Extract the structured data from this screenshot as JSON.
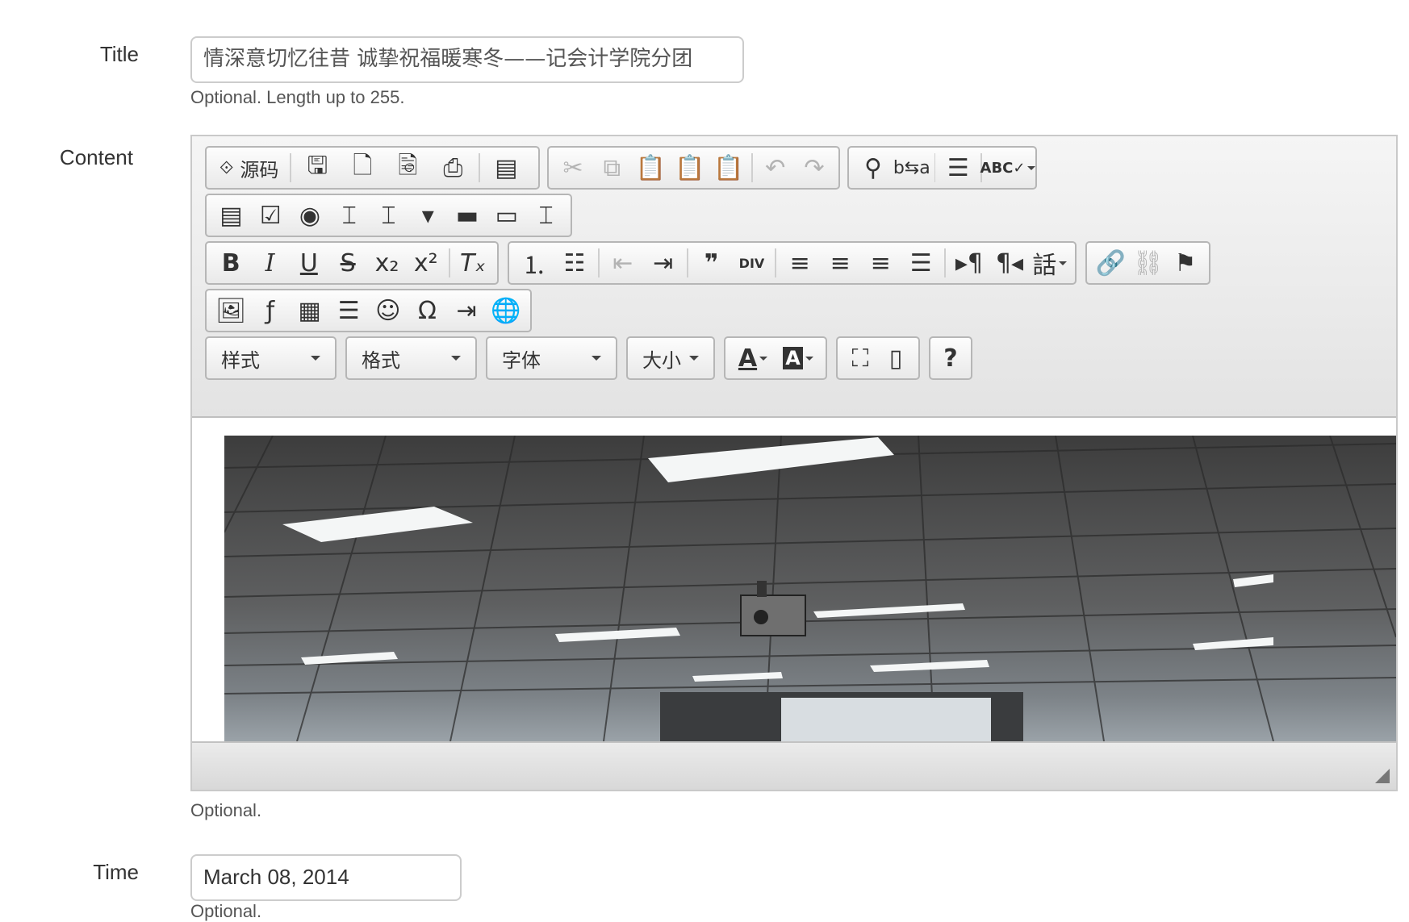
{
  "form": {
    "title_label": "Title",
    "title_value": "情深意切忆往昔 诚挚祝福暖寒冬——记会计学院分团",
    "title_help": "Optional. Length up to 255.",
    "content_label": "Content",
    "content_help": "Optional.",
    "time_label": "Time",
    "time_value": "March 08, 2014",
    "time_help": "Optional."
  },
  "editor": {
    "source_label": "源码",
    "combos": {
      "style": "样式",
      "format": "格式",
      "font": "字体",
      "size": "大小"
    },
    "help_label": "?"
  }
}
